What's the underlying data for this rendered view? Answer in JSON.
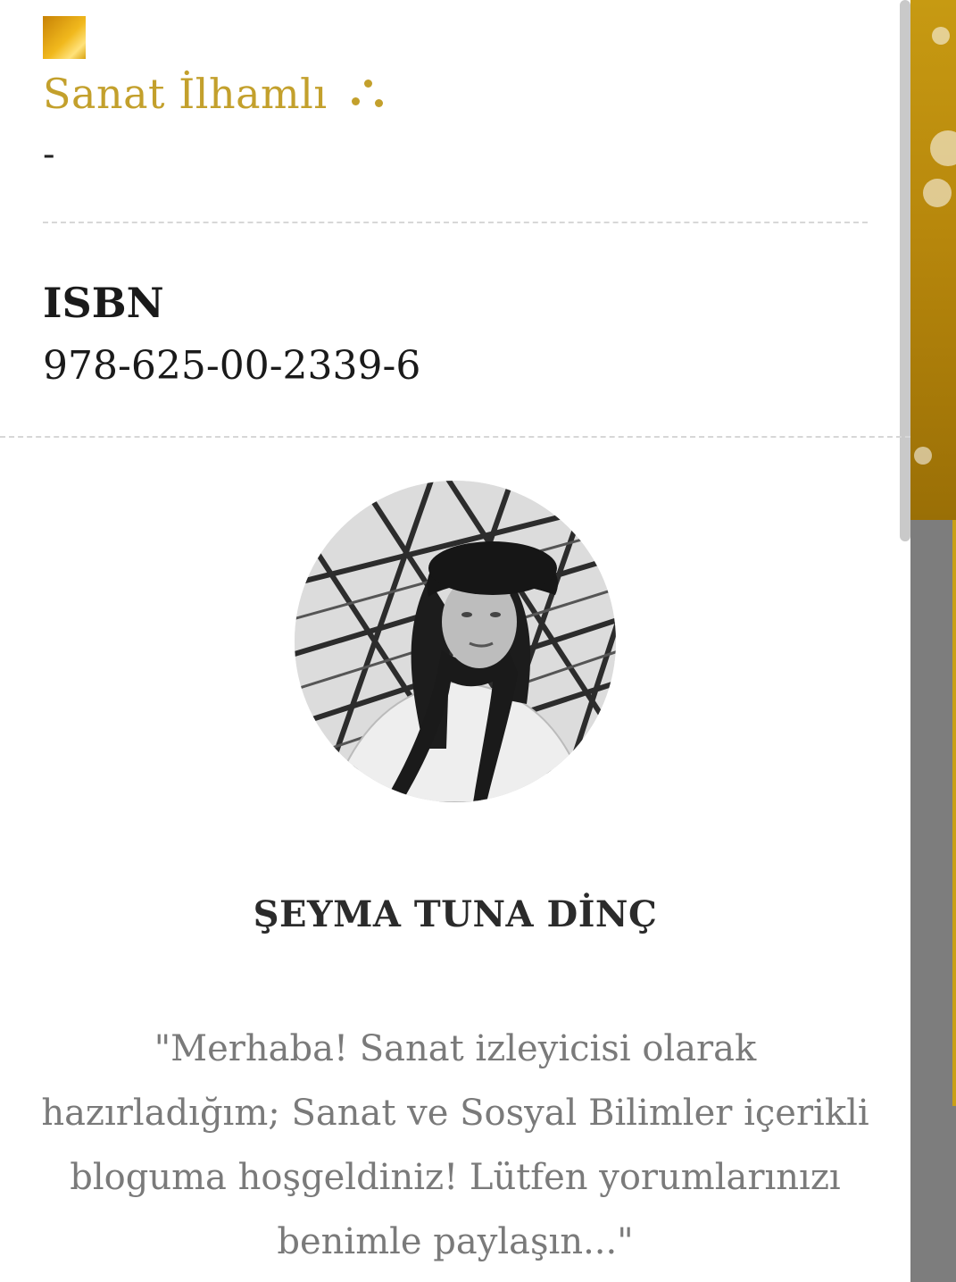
{
  "header": {
    "logo_icon": "blog-logo-icon",
    "blog_title": "Sanat İlhamlı",
    "title_icon": "three-dots-icon",
    "subtitle": "-"
  },
  "book_info": {
    "isbn_label": "ISBN",
    "isbn_value": "978-625-00-2339-6"
  },
  "author": {
    "avatar_icon": "profile-photo",
    "name": "ŞEYMA TUNA DİNÇ",
    "bio": "\"Merhaba! Sanat izleyicisi olarak hazırladığım; Sanat ve Sosyal Bilimler içerikli bloguma hoşgeldiniz! Lütfen yorumlarınızı benimle paylaşın...\""
  },
  "colors": {
    "accent_gold": "#c3a02c",
    "text_dark": "#1a1a1a",
    "text_muted": "#7a7a7a",
    "background_strip": "#7d7d7d"
  }
}
